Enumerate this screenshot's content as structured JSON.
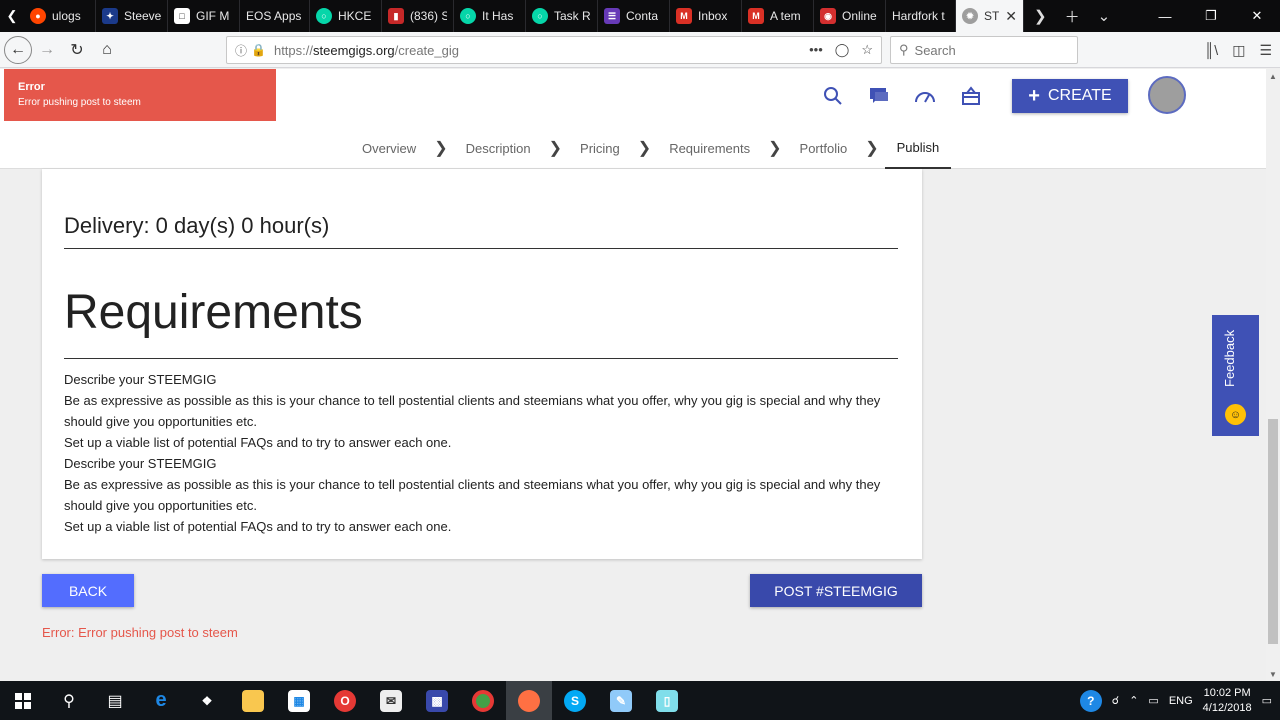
{
  "browser": {
    "tabs": [
      {
        "label": "ulogs",
        "icon": "reddit-icon",
        "color": "#ff4500"
      },
      {
        "label": "Steeve",
        "icon": "steeve-icon",
        "color": "#1b3a8a"
      },
      {
        "label": "GIF M",
        "icon": "document-icon",
        "color": "#ffffff"
      },
      {
        "label": "EOS Apps",
        "icon": "",
        "color": ""
      },
      {
        "label": "HKCE",
        "icon": "steemit-icon",
        "color": "#06d6a9"
      },
      {
        "label": "(836) S",
        "icon": "badge-icon",
        "color": "#c62828"
      },
      {
        "label": "It Has",
        "icon": "steemit-icon",
        "color": "#06d6a9"
      },
      {
        "label": "Task R",
        "icon": "steemit-icon",
        "color": "#06d6a9"
      },
      {
        "label": "Conta",
        "icon": "form-icon",
        "color": "#673ab7"
      },
      {
        "label": "Inbox",
        "icon": "gmail-icon",
        "color": "#d93025"
      },
      {
        "label": "A tem",
        "icon": "gmail-icon",
        "color": "#d93025"
      },
      {
        "label": "Online",
        "icon": "target-icon",
        "color": "#d32f2f"
      },
      {
        "label": "Hardfork t",
        "icon": "",
        "color": ""
      },
      {
        "label": "STE",
        "icon": "gear-icon",
        "color": "#9e9e9e"
      }
    ],
    "url_prefix": "https://",
    "url_host": "steemgigs.org",
    "url_path": "/create_gig",
    "search_placeholder": "Search",
    "url_more": "•••"
  },
  "toast": {
    "title": "Error",
    "message": "Error pushing post to steem"
  },
  "header": {
    "create_label": "CREATE"
  },
  "steps": [
    {
      "label": "Overview"
    },
    {
      "label": "Description"
    },
    {
      "label": "Pricing"
    },
    {
      "label": "Requirements"
    },
    {
      "label": "Portfolio"
    },
    {
      "label": "Publish"
    }
  ],
  "card": {
    "delivery": "Delivery: 0 day(s) 0 hour(s)",
    "requirements_title": "Requirements",
    "lines": [
      "Describe your STEEMGIG",
      "Be as expressive as possible as this is your chance to tell postential clients and steemians what you offer, why you gig is special and why they should give you opportunities etc.",
      "Set up a viable list of potential FAQs and to try to answer each one.",
      "Describe your STEEMGIG",
      "Be as expressive as possible as this is your chance to tell postential clients and steemians what you offer, why you gig is special and why they should give you opportunities etc.",
      "Set up a viable list of potential FAQs and to try to answer each one."
    ]
  },
  "actions": {
    "back_label": "BACK",
    "post_label": "POST #STEEMGIG",
    "error_text": "Error: Error pushing post to steem"
  },
  "feedback": {
    "label": "Feedback"
  },
  "taskbar": {
    "language": "ENG",
    "time": "10:02 PM",
    "date": "4/12/2018"
  },
  "colors": {
    "brand": "#3f51b5",
    "error": "#e5574b",
    "back_button": "#536dfe",
    "post_button": "#3949ab"
  }
}
